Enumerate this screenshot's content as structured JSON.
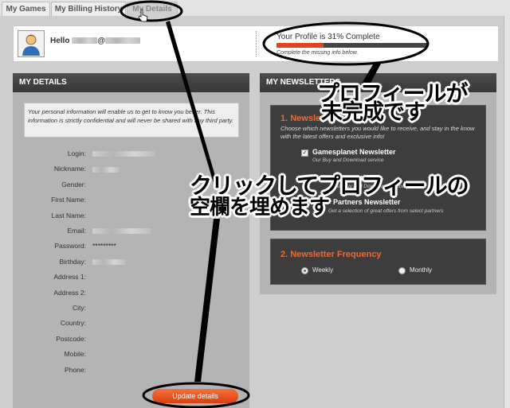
{
  "tabs": [
    {
      "label": "My Games",
      "active": false
    },
    {
      "label": "My Billing History",
      "active": false
    },
    {
      "label": "My Details",
      "active": true
    }
  ],
  "header": {
    "greeting": "Hello",
    "at_sign": "@",
    "profile_status": "Your Profile is 31% Complete",
    "profile_percent": 31,
    "profile_hint": "Complete the missing info below."
  },
  "details": {
    "title": "MY DETAILS",
    "intro": "Your personal information will enable us to get to know you better. This information is strictly confidential and will never be shared with any third party.",
    "fields": [
      {
        "label": "Login:",
        "value": "",
        "blurred": true
      },
      {
        "label": "Nickname:",
        "value": "",
        "blurred": true
      },
      {
        "label": "Gender:",
        "value": "",
        "blurred": false
      },
      {
        "label": "First Name:",
        "value": "",
        "blurred": false
      },
      {
        "label": "Last Name:",
        "value": "",
        "blurred": false
      },
      {
        "label": "Email:",
        "value": "",
        "blurred": true
      },
      {
        "label": "Password:",
        "value": "*********",
        "blurred": false
      },
      {
        "label": "Birthday:",
        "value": "",
        "blurred": true
      },
      {
        "label": "Address 1:",
        "value": "",
        "blurred": false
      },
      {
        "label": "Address 2:",
        "value": "",
        "blurred": false
      },
      {
        "label": "City:",
        "value": "",
        "blurred": false
      },
      {
        "label": "Country:",
        "value": "",
        "blurred": false
      },
      {
        "label": "Postcode:",
        "value": "",
        "blurred": false
      },
      {
        "label": "Mobile:",
        "value": "",
        "blurred": false
      },
      {
        "label": "Phone:",
        "value": "",
        "blurred": false
      }
    ],
    "update_button": "Update details"
  },
  "newsletters": {
    "title": "MY NEWSLETTERS",
    "section1_title": "1. Newsletter",
    "section1_desc": "Choose which newsletters you would like to receive, and stay in the know with the latest offers and exclusive info!",
    "items": [
      {
        "name": "Gamesplanet Newsletter",
        "sub": "Our Buy and Download service",
        "checked": true
      },
      {
        "name": "Newsletter",
        "sub": "Our Buy and Download service",
        "checked": false
      },
      {
        "name": "Partners Newsletter",
        "sub": "Get a selection of great offers from select partners",
        "checked": false
      }
    ],
    "section2_title": "2. Newsletter Frequency",
    "frequency_options": [
      "Weekly",
      "Monthly"
    ],
    "frequency_selected": "Weekly"
  },
  "annotations": {
    "incomplete_line1": "プロフィールが",
    "incomplete_line2": "未完成です",
    "click_line1": "クリックしてプロフィールの",
    "click_line2": "空欄を埋めます"
  },
  "colors": {
    "accent": "#e2431c",
    "panel_header": "#3c3c3c",
    "annotation_stroke": "#000000"
  }
}
